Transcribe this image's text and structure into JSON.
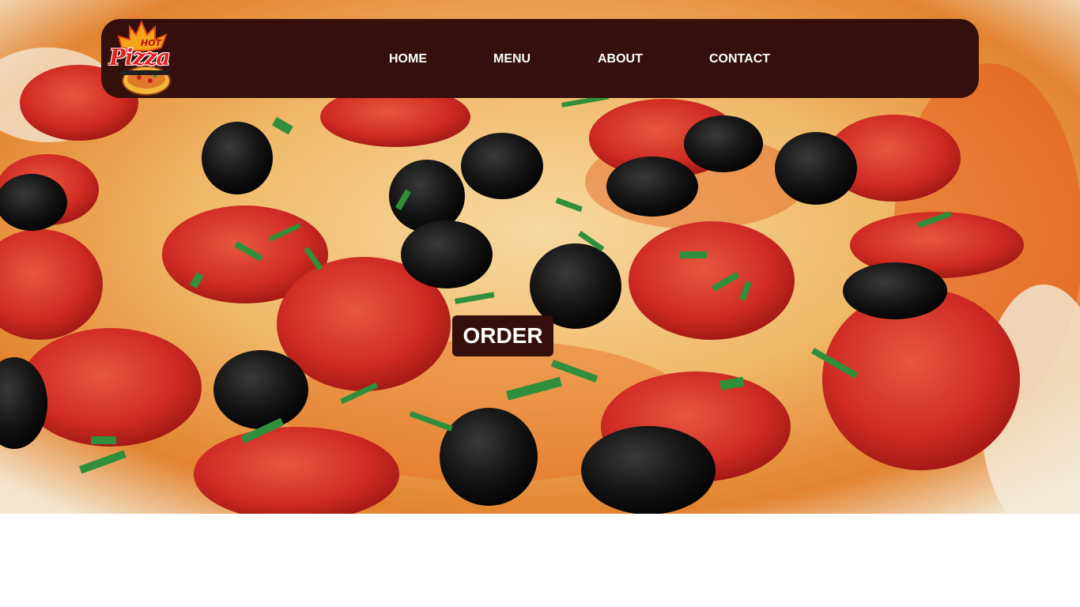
{
  "logo": {
    "text_top": "HOT",
    "text_main": "Pizza"
  },
  "nav": {
    "items": [
      {
        "label": "HOME"
      },
      {
        "label": "MENU"
      },
      {
        "label": "ABOUT"
      },
      {
        "label": "CONTACT"
      }
    ]
  },
  "hero": {
    "cta_label": "ORDER",
    "image_subject": "pepperoni-olive-pizza-photo"
  },
  "colors": {
    "nav_bg": "#340f0b",
    "nav_text": "#ffffff",
    "cta_bg": "#340f0b",
    "cta_text": "#ffffff",
    "page_bg": "#ffffff"
  }
}
